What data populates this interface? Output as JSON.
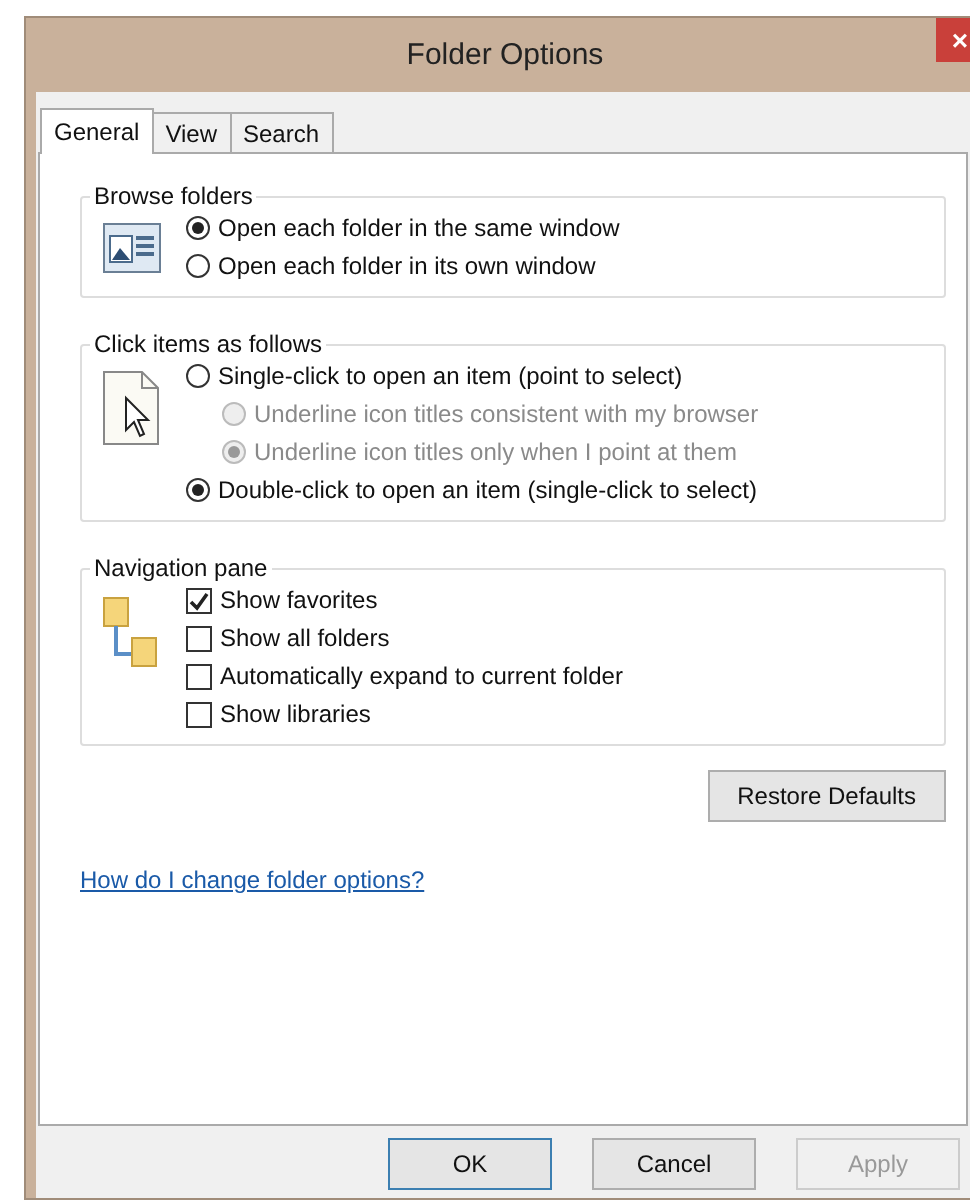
{
  "window": {
    "title": "Folder Options",
    "close": "×"
  },
  "tabs": [
    {
      "label": "General",
      "selected": true
    },
    {
      "label": "View",
      "selected": false
    },
    {
      "label": "Search",
      "selected": false
    }
  ],
  "browse_folders": {
    "legend": "Browse folders",
    "options": [
      {
        "label": "Open each folder in the same window",
        "selected": true
      },
      {
        "label": "Open each folder in its own window",
        "selected": false
      }
    ]
  },
  "click_items": {
    "legend": "Click items as follows",
    "options": [
      {
        "kind": "radio",
        "label": "Single-click to open an item (point to select)",
        "selected": false,
        "disabled": false
      },
      {
        "kind": "sub_radio",
        "label": "Underline icon titles consistent with my browser",
        "selected": false,
        "disabled": true
      },
      {
        "kind": "sub_radio",
        "label": "Underline icon titles only when I point at them",
        "selected": true,
        "disabled": true
      },
      {
        "kind": "radio",
        "label": "Double-click to open an item (single-click to select)",
        "selected": true,
        "disabled": false
      }
    ]
  },
  "navigation_pane": {
    "legend": "Navigation pane",
    "options": [
      {
        "label": "Show favorites",
        "checked": true
      },
      {
        "label": "Show all folders",
        "checked": false
      },
      {
        "label": "Automatically expand to current folder",
        "checked": false
      },
      {
        "label": "Show libraries",
        "checked": false
      }
    ]
  },
  "restore_button": "Restore Defaults",
  "help_link": "How do I change folder options?",
  "buttons": [
    {
      "label": "OK",
      "disabled": false,
      "default": true
    },
    {
      "label": "Cancel",
      "disabled": false,
      "default": false
    },
    {
      "label": "Apply",
      "disabled": true,
      "default": false
    }
  ]
}
